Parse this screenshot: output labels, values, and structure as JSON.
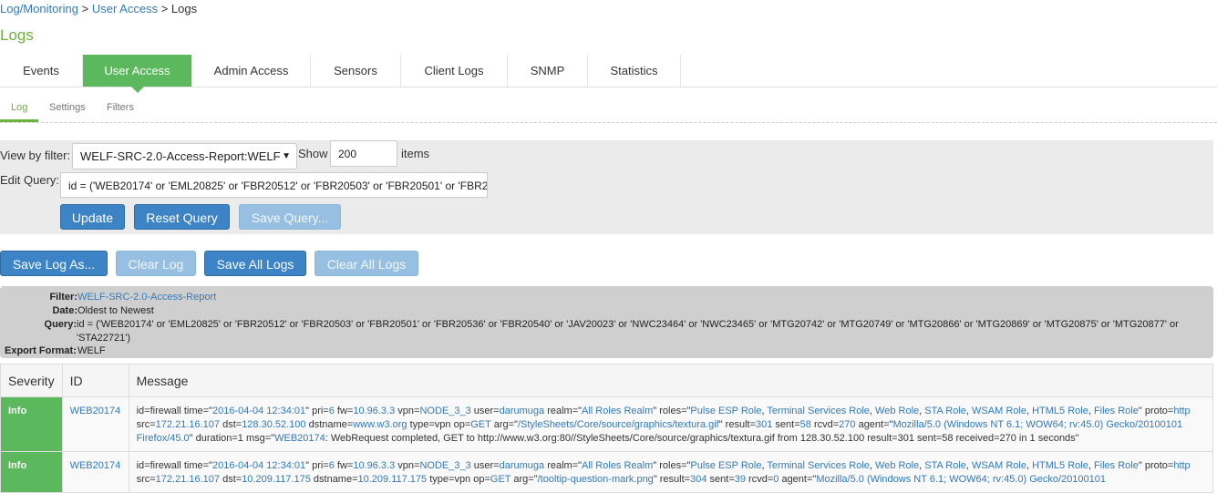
{
  "breadcrumb": {
    "part1": "Log/Monitoring",
    "sep1": " > ",
    "part2": "User Access",
    "sep2": " > ",
    "current": "Logs"
  },
  "page_title": "Logs",
  "tabs": [
    {
      "label": "Events",
      "active": false
    },
    {
      "label": "User Access",
      "active": true
    },
    {
      "label": "Admin Access",
      "active": false
    },
    {
      "label": "Sensors",
      "active": false
    },
    {
      "label": "Client Logs",
      "active": false
    },
    {
      "label": "SNMP",
      "active": false
    },
    {
      "label": "Statistics",
      "active": false
    }
  ],
  "subtabs": [
    {
      "label": "Log",
      "active": true
    },
    {
      "label": "Settings",
      "active": false
    },
    {
      "label": "Filters",
      "active": false
    }
  ],
  "filter": {
    "view_by_label": "View by filter:",
    "selected": "WELF-SRC-2.0-Access-Report:WELF",
    "show_label": "Show",
    "show_value": "200",
    "items_label": "items",
    "edit_query_label": "Edit Query:",
    "query_value": "id = ('WEB20174' or 'EML20825' or 'FBR20512' or 'FBR20503' or 'FBR20501' or 'FBR20536' or 'FBR20540' or 'JAV20023' or 'NWC23464' or 'NWC23465' or 'MTG20742' or 'MTG20749' or 'MTG20866' or 'MTG20869' or 'MTG20875' or 'MTG20877' or 'STA22721')",
    "update_label": "Update",
    "reset_label": "Reset Query",
    "save_query_label": "Save Query..."
  },
  "actions": {
    "save_log_as": "Save Log As...",
    "clear_log": "Clear Log",
    "save_all_logs": "Save All Logs",
    "clear_all_logs": "Clear All Logs"
  },
  "info": {
    "filter_key": "Filter:",
    "filter_value": "WELF-SRC-2.0-Access-Report",
    "date_key": "Date:",
    "date_value": "Oldest to Newest",
    "query_key": "Query:",
    "query_line1": "id = ('WEB20174' or 'EML20825' or 'FBR20512' or 'FBR20503' or 'FBR20501' or 'FBR20536' or 'FBR20540' or 'JAV20023' or 'NWC23464' or 'NWC23465' or 'MTG20742' or 'MTG20749' or 'MTG20866' or 'MTG20869' or 'MTG20875' or 'MTG20877' or",
    "query_line2": "'STA22721')",
    "export_key": "Export Format:",
    "export_value": "WELF"
  },
  "table": {
    "headers": [
      "Severity",
      "ID",
      "Message"
    ],
    "rows": [
      {
        "severity": "Info",
        "id": "WEB20174",
        "message": [
          {
            "t": "id=firewall time=\""
          },
          {
            "t": "2016-04-04 12:34:01",
            "l": true
          },
          {
            "t": "\" pri="
          },
          {
            "t": "6",
            "l": true
          },
          {
            "t": " fw="
          },
          {
            "t": "10.96.3.3",
            "l": true
          },
          {
            "t": " vpn="
          },
          {
            "t": "NODE_3_3",
            "l": true
          },
          {
            "t": " user="
          },
          {
            "t": "darumuga",
            "l": true
          },
          {
            "t": " realm=\""
          },
          {
            "t": "All Roles Realm",
            "l": true
          },
          {
            "t": "\" roles=\""
          },
          {
            "t": "Pulse ESP Role",
            "l": true
          },
          {
            "t": ", "
          },
          {
            "t": "Terminal Services Role",
            "l": true
          },
          {
            "t": ", "
          },
          {
            "t": "Web Role",
            "l": true
          },
          {
            "t": ", "
          },
          {
            "t": "STA Role",
            "l": true
          },
          {
            "t": ", "
          },
          {
            "t": "WSAM Role",
            "l": true
          },
          {
            "t": ", "
          },
          {
            "t": "HTML5 Role",
            "l": true
          },
          {
            "t": ", "
          },
          {
            "t": "Files Role",
            "l": true
          },
          {
            "t": "\" proto="
          },
          {
            "t": "http",
            "l": true
          },
          {
            "t": " src="
          },
          {
            "t": "172.21.16.107",
            "l": true
          },
          {
            "t": " dst="
          },
          {
            "t": "128.30.52.100",
            "l": true
          },
          {
            "t": " dstname="
          },
          {
            "t": "www.w3.org",
            "l": true
          },
          {
            "t": " type=vpn op="
          },
          {
            "t": "GET",
            "l": true
          },
          {
            "t": " arg=\""
          },
          {
            "t": "/StyleSheets/Core/source/graphics/textura.gif",
            "l": true
          },
          {
            "t": "\" result="
          },
          {
            "t": "301",
            "l": true
          },
          {
            "t": " sent="
          },
          {
            "t": "58",
            "l": true
          },
          {
            "t": " rcvd="
          },
          {
            "t": "270",
            "l": true
          },
          {
            "t": " agent=\""
          },
          {
            "t": "Mozilla/5.0 (Windows NT 6.1; WOW64; rv:45.0) Gecko/20100101 Firefox/45.0",
            "l": true
          },
          {
            "t": "\" duration=1 msg=\""
          },
          {
            "t": "WEB20174",
            "l": true
          },
          {
            "t": ": WebRequest completed, GET to http://www.w3.org:80//StyleSheets/Core/source/graphics/textura.gif from 128.30.52.100 result=301 sent=58 received=270 in 1 seconds\""
          }
        ]
      },
      {
        "severity": "Info",
        "id": "WEB20174",
        "message": [
          {
            "t": "id=firewall time=\""
          },
          {
            "t": "2016-04-04 12:34:01",
            "l": true
          },
          {
            "t": "\" pri="
          },
          {
            "t": "6",
            "l": true
          },
          {
            "t": " fw="
          },
          {
            "t": "10.96.3.3",
            "l": true
          },
          {
            "t": " vpn="
          },
          {
            "t": "NODE_3_3",
            "l": true
          },
          {
            "t": " user="
          },
          {
            "t": "darumuga",
            "l": true
          },
          {
            "t": " realm=\""
          },
          {
            "t": "All Roles Realm",
            "l": true
          },
          {
            "t": "\" roles=\""
          },
          {
            "t": "Pulse ESP Role",
            "l": true
          },
          {
            "t": ", "
          },
          {
            "t": "Terminal Services Role",
            "l": true
          },
          {
            "t": ", "
          },
          {
            "t": "Web Role",
            "l": true
          },
          {
            "t": ", "
          },
          {
            "t": "STA Role",
            "l": true
          },
          {
            "t": ", "
          },
          {
            "t": "WSAM Role",
            "l": true
          },
          {
            "t": ", "
          },
          {
            "t": "HTML5 Role",
            "l": true
          },
          {
            "t": ", "
          },
          {
            "t": "Files Role",
            "l": true
          },
          {
            "t": "\" proto="
          },
          {
            "t": "http",
            "l": true
          },
          {
            "t": " src="
          },
          {
            "t": "172.21.16.107",
            "l": true
          },
          {
            "t": " dst="
          },
          {
            "t": "10.209.117.175",
            "l": true
          },
          {
            "t": " dstname="
          },
          {
            "t": "10.209.117.175",
            "l": true
          },
          {
            "t": " type=vpn op="
          },
          {
            "t": "GET",
            "l": true
          },
          {
            "t": " arg=\""
          },
          {
            "t": "/tooltip-question-mark.png",
            "l": true
          },
          {
            "t": "\" result="
          },
          {
            "t": "304",
            "l": true
          },
          {
            "t": " sent="
          },
          {
            "t": "39",
            "l": true
          },
          {
            "t": " rcvd="
          },
          {
            "t": "0",
            "l": true
          },
          {
            "t": " agent=\""
          },
          {
            "t": "Mozilla/5.0 (Windows NT 6.1; WOW64; rv:45.0) Gecko/20100101",
            "l": true
          }
        ]
      }
    ]
  }
}
